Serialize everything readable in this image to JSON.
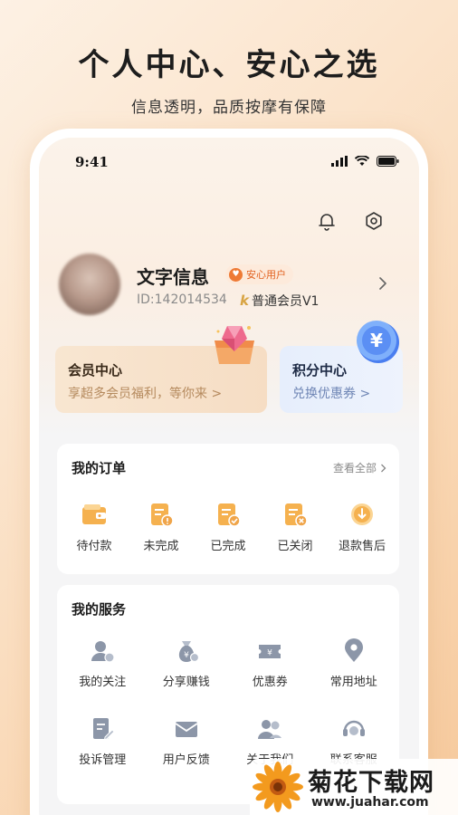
{
  "hero": {
    "title": "个人中心、安心之选",
    "subtitle": "信息透明，品质按摩有保障"
  },
  "status_bar": {
    "time": "9:41",
    "icons": [
      "signal-icon",
      "wifi-icon",
      "battery-icon"
    ]
  },
  "header_icons": [
    "bell-icon",
    "settings-icon"
  ],
  "profile": {
    "name": "文字信息",
    "badge": "安心用户",
    "id_text": "ID:142014534",
    "level_mark": "k",
    "level": "普通会员V1"
  },
  "member_card": {
    "title": "会员中心",
    "subtitle": "享超多会员福利，等你来 >"
  },
  "points_card": {
    "title": "积分中心",
    "subtitle": "兑换优惠券 >",
    "coin_symbol": "¥"
  },
  "orders": {
    "title": "我的订单",
    "view_all": "查看全部",
    "items": [
      {
        "label": "待付款",
        "icon": "wallet-icon"
      },
      {
        "label": "未完成",
        "icon": "pending-order-icon"
      },
      {
        "label": "已完成",
        "icon": "completed-order-icon"
      },
      {
        "label": "已关闭",
        "icon": "closed-order-icon"
      },
      {
        "label": "退款售后",
        "icon": "refund-icon"
      }
    ]
  },
  "services": {
    "title": "我的服务",
    "items": [
      {
        "label": "我的关注",
        "icon": "follow-user-icon"
      },
      {
        "label": "分享赚钱",
        "icon": "money-bag-icon"
      },
      {
        "label": "优惠券",
        "icon": "coupon-icon"
      },
      {
        "label": "常用地址",
        "icon": "location-pin-icon"
      },
      {
        "label": "投诉管理",
        "icon": "complaint-edit-icon"
      },
      {
        "label": "用户反馈",
        "icon": "feedback-mail-icon"
      },
      {
        "label": "关于我们",
        "icon": "about-us-icon"
      },
      {
        "label": "联系客服",
        "icon": "customer-service-icon"
      }
    ]
  },
  "watermark": {
    "title": "菊花下载网",
    "url": "www.juahar.com"
  },
  "colors": {
    "accent_orange": "#f0a54a",
    "badge_orange": "#e2611f",
    "service_gray": "#8c96a8",
    "points_blue": "#6f86b5"
  }
}
